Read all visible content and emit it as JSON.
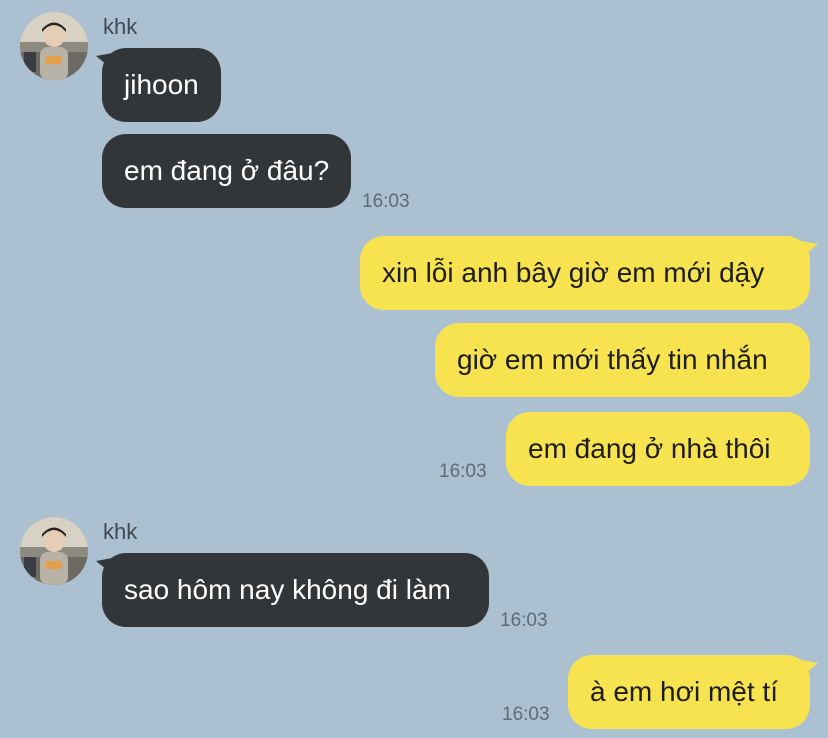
{
  "colors": {
    "background": "#abc1d1",
    "incoming_bubble": "#333638",
    "outgoing_bubble": "#f7e34f"
  },
  "groups": [
    {
      "sender": "khk",
      "messages": [
        "jihoon",
        "em đang ở đâu?"
      ],
      "time": "16:03"
    },
    {
      "messages": [
        "xin lỗi anh bây giờ em mới dậy",
        "giờ em mới thấy tin nhắn",
        "em đang ở nhà thôi"
      ],
      "time": "16:03"
    },
    {
      "sender": "khk",
      "messages": [
        "sao hôm nay không đi làm"
      ],
      "time": "16:03"
    },
    {
      "messages": [
        "à em hơi mệt tí"
      ],
      "time": "16:03"
    }
  ]
}
